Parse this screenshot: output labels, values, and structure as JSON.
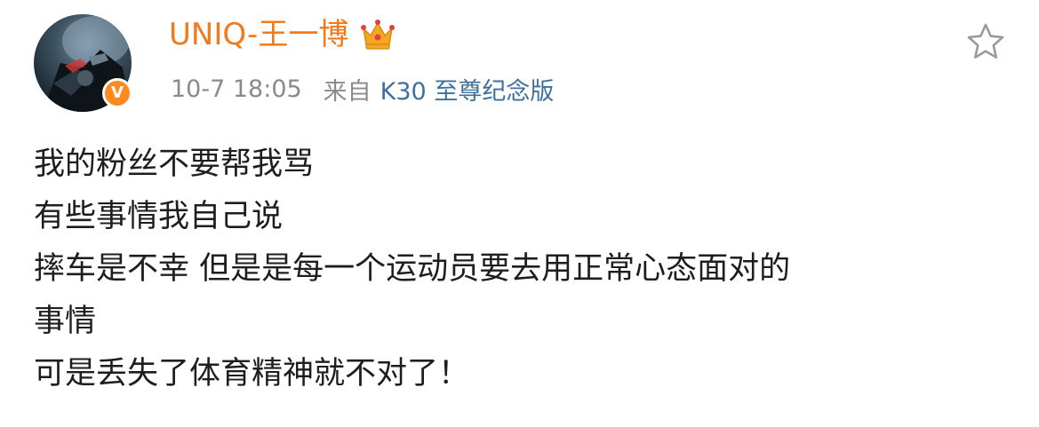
{
  "post": {
    "username": "UNIQ-王一博",
    "time": "10-7 18:05",
    "source_prefix": "来自",
    "device": "K30 至尊纪念版",
    "verified_badge": "V",
    "lines": [
      "我的粉丝不要帮我骂",
      "有些事情我自己说",
      "摔车是不幸 但是是每一个运动员要去用正常心态面对的",
      "事情",
      "可是丢失了体育精神就不对了！"
    ]
  },
  "icons": {
    "crown": "crown-icon",
    "star": "star-icon",
    "verified": "verified-badge-icon"
  },
  "colors": {
    "username": "#f07a1c",
    "meta_text": "#8a8a8a",
    "device_link": "#3d6f9f",
    "badge": "#ff8a1f",
    "body_text": "#1e1e1e"
  }
}
